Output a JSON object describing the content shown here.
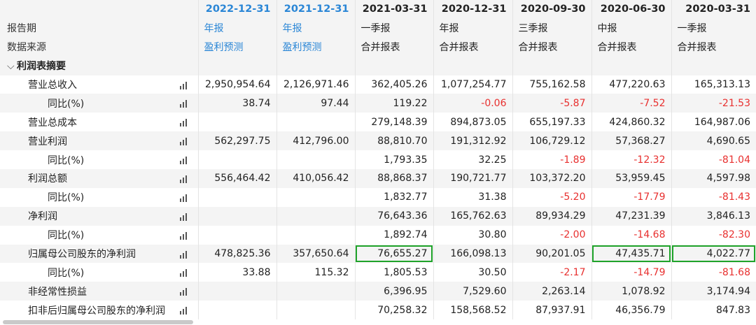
{
  "header": {
    "periods": [
      "2022-12-31",
      "2021-12-31",
      "2021-03-31",
      "2020-12-31",
      "2020-09-30",
      "2020-06-30",
      "2020-03-31"
    ]
  },
  "report_period": {
    "label": "报告期",
    "values": [
      "年报",
      "年报",
      "一季报",
      "年报",
      "三季报",
      "中报",
      "一季报"
    ]
  },
  "data_source": {
    "label": "数据来源",
    "values": [
      "盈利预测",
      "盈利预测",
      "合并报表",
      "合并报表",
      "合并报表",
      "合并报表",
      "合并报表"
    ]
  },
  "section": {
    "label": "利润表摘要",
    "chevron_icon": "chevron-down-icon"
  },
  "rows": [
    {
      "label": "营业总收入",
      "indent": 1,
      "values": [
        "2,950,954.64",
        "2,126,971.46",
        "362,405.26",
        "1,077,254.77",
        "755,162.58",
        "477,220.63",
        "165,313.13"
      ]
    },
    {
      "label": "同比(%)",
      "indent": 2,
      "values": [
        "38.74",
        "97.44",
        "119.22",
        "-0.06",
        "-5.87",
        "-7.52",
        "-21.53"
      ]
    },
    {
      "label": "营业总成本",
      "indent": 1,
      "values": [
        "",
        "",
        "279,148.39",
        "894,873.05",
        "655,197.33",
        "424,860.32",
        "164,987.06"
      ]
    },
    {
      "label": "营业利润",
      "indent": 1,
      "values": [
        "562,297.75",
        "412,796.00",
        "88,810.70",
        "191,312.92",
        "106,729.12",
        "57,368.27",
        "4,690.65"
      ]
    },
    {
      "label": "同比(%)",
      "indent": 2,
      "values": [
        "",
        "",
        "1,793.35",
        "32.25",
        "-1.89",
        "-12.32",
        "-81.04"
      ]
    },
    {
      "label": "利润总额",
      "indent": 1,
      "values": [
        "556,464.42",
        "410,056.42",
        "88,868.37",
        "190,721.77",
        "103,372.20",
        "53,959.45",
        "4,597.98"
      ]
    },
    {
      "label": "同比(%)",
      "indent": 2,
      "values": [
        "",
        "",
        "1,832.77",
        "31.38",
        "-5.20",
        "-17.79",
        "-81.43"
      ]
    },
    {
      "label": "净利润",
      "indent": 1,
      "values": [
        "",
        "",
        "76,643.36",
        "165,762.63",
        "89,934.29",
        "47,231.39",
        "3,846.13"
      ]
    },
    {
      "label": "同比(%)",
      "indent": 2,
      "values": [
        "",
        "",
        "1,892.74",
        "30.80",
        "-2.00",
        "-14.68",
        "-82.30"
      ]
    },
    {
      "label": "归属母公司股东的净利润",
      "indent": 1,
      "values": [
        "478,825.36",
        "357,650.64",
        "76,655.27",
        "166,098.13",
        "90,201.05",
        "47,435.71",
        "4,022.77"
      ]
    },
    {
      "label": "同比(%)",
      "indent": 2,
      "values": [
        "33.88",
        "115.32",
        "1,805.53",
        "30.50",
        "-2.17",
        "-14.79",
        "-81.68"
      ]
    },
    {
      "label": "非经常性损益",
      "indent": 1,
      "values": [
        "",
        "",
        "6,396.95",
        "7,529.60",
        "2,263.14",
        "1,078.92",
        "3,174.94"
      ]
    },
    {
      "label": "扣非后归属母公司股东的净利润",
      "indent": 1,
      "values": [
        "",
        "",
        "70,258.32",
        "158,568.52",
        "87,937.91",
        "46,356.79",
        "847.83"
      ]
    }
  ],
  "colors": {
    "forecast": "#2a86d6",
    "negative": "#e8302f",
    "highlight_box": "#1fa32a"
  },
  "highlighted_cells": [
    {
      "row": 9,
      "col": 2
    },
    {
      "row": 9,
      "col": 5
    },
    {
      "row": 9,
      "col": 6
    }
  ]
}
